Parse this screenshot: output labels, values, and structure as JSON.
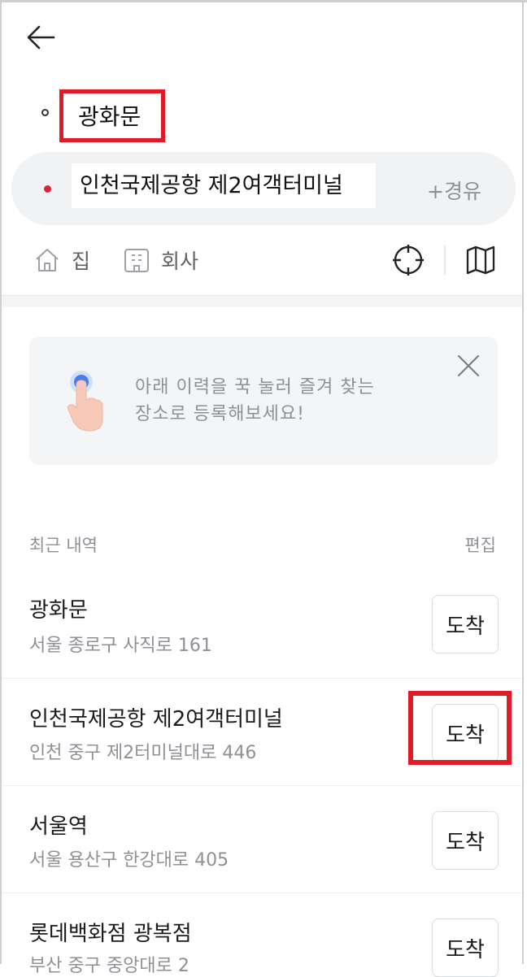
{
  "route": {
    "origin": "광화문",
    "destination": "인천국제공항 제2여객터미널",
    "waypoint_button": "+경유"
  },
  "shortcuts": [
    {
      "label": "집",
      "icon": "home-icon"
    },
    {
      "label": "회사",
      "icon": "building-icon"
    }
  ],
  "tools": [
    {
      "icon": "current-location-icon"
    },
    {
      "icon": "map-icon"
    }
  ],
  "tip": {
    "line1": "아래 이력을 꾹 눌러 즐겨 찾는",
    "line2": "장소로 등록해보세요!"
  },
  "recent": {
    "title": "최근 내역",
    "edit_label": "편집",
    "items": [
      {
        "name": "광화문",
        "address": "서울 종로구 사직로 161",
        "action": "도착"
      },
      {
        "name": "인천국제공항 제2여객터미널",
        "address": "인천 중구 제2터미널대로 446",
        "action": "도착"
      },
      {
        "name": "서울역",
        "address": "서울 용산구 한강대로 405",
        "action": "도착"
      },
      {
        "name": "롯데백화점 광복점",
        "address": "부산 중구 중앙대로 2",
        "action": "도착"
      }
    ]
  },
  "colors": {
    "highlight": "#e11a2a",
    "destination_dot": "#d7263a"
  }
}
